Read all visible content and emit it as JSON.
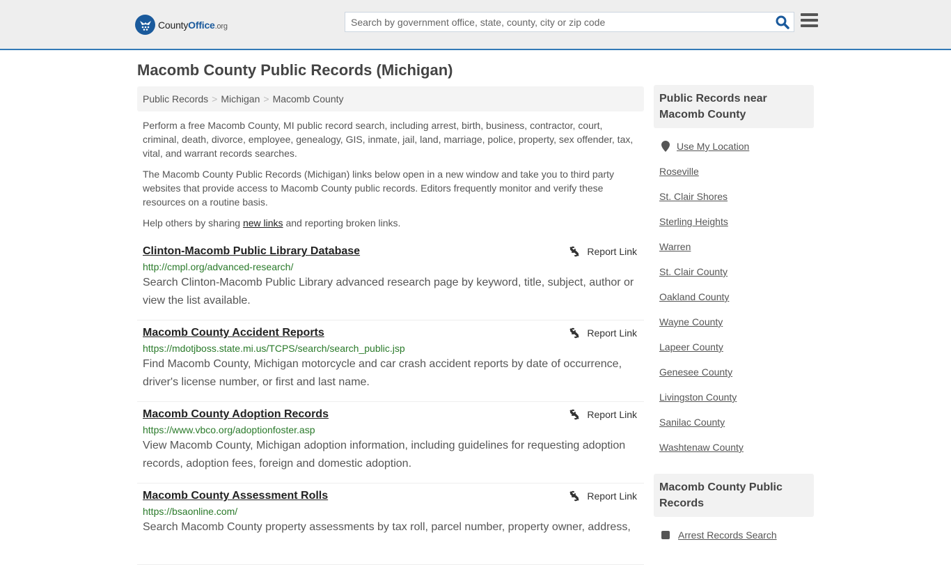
{
  "header": {
    "logo": {
      "county": "County",
      "office": "Office",
      "org": ".org"
    },
    "search": {
      "placeholder": "Search by government office, state, county, city or zip code",
      "value": ""
    },
    "colors": {
      "brand": "#1a5a9c",
      "accent_border": "#337ab7"
    }
  },
  "page": {
    "title": "Macomb County Public Records (Michigan)",
    "breadcrumb": [
      "Public Records",
      "Michigan",
      "Macomb County"
    ],
    "intro": {
      "p1": "Perform a free Macomb County, MI public record search, including arrest, birth, business, contractor, court, criminal, death, divorce, employee, genealogy, GIS, inmate, jail, land, marriage, police, property, sex offender, tax, vital, and warrant records searches.",
      "p2": "The Macomb County Public Records (Michigan) links below open in a new window and take you to third party websites that provide access to Macomb County public records. Editors frequently monitor and verify these resources on a routine basis.",
      "p3_before": "Help others by sharing ",
      "p3_link": "new links",
      "p3_after": " and reporting broken links."
    }
  },
  "records": [
    {
      "title": "Clinton-Macomb Public Library Database",
      "url": "http://cmpl.org/advanced-research/",
      "description": "Search Clinton-Macomb Public Library advanced research page by keyword, title, subject, author or view the list available.",
      "report_label": "Report Link"
    },
    {
      "title": "Macomb County Accident Reports",
      "url": "https://mdotjboss.state.mi.us/TCPS/search/search_public.jsp",
      "description": "Find Macomb County, Michigan motorcycle and car crash accident reports by date of occurrence, driver's license number, or first and last name.",
      "report_label": "Report Link"
    },
    {
      "title": "Macomb County Adoption Records",
      "url": "https://www.vbco.org/adoptionfoster.asp",
      "description": "View Macomb County, Michigan adoption information, including guidelines for requesting adoption records, adoption fees, foreign and domestic adoption.",
      "report_label": "Report Link"
    },
    {
      "title": "Macomb County Assessment Rolls",
      "url": "https://bsaonline.com/",
      "description": "Search Macomb County property assessments by tax roll, parcel number, property owner, address,",
      "report_label": "Report Link"
    }
  ],
  "sidebar": {
    "nearby_heading": "Public Records near Macomb County",
    "use_location": "Use My Location",
    "nearby": [
      "Roseville",
      "St. Clair Shores",
      "Sterling Heights",
      "Warren",
      "St. Clair County",
      "Oakland County",
      "Wayne County",
      "Lapeer County",
      "Genesee County",
      "Livingston County",
      "Sanilac County",
      "Washtenaw County"
    ],
    "county_heading": "Macomb County Public Records",
    "county_links": [
      "Arrest Records Search"
    ]
  }
}
